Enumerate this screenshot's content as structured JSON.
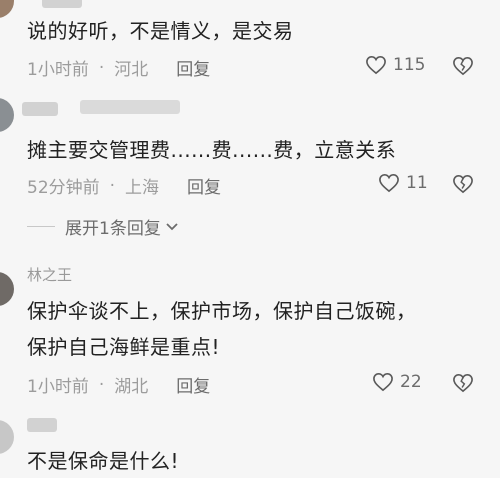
{
  "comments": [
    {
      "text": "说的好听，不是情义，是交易",
      "time": "1小时前",
      "location": "河北",
      "reply": "回复",
      "likes": "115"
    },
    {
      "text": "摊主要交管理费......费......费，立意关系",
      "time": "52分钟前",
      "location": "上海",
      "reply": "回复",
      "likes": "11",
      "expand": "展开1条回复"
    },
    {
      "name": "林之王",
      "text_line1": "保护伞谈不上，保护市场，保护自己饭碗，",
      "text_line2": "保护自己海鲜是重点!",
      "time": "1小时前",
      "location": "湖北",
      "reply": "回复",
      "likes": "22"
    },
    {
      "text": "不是保命是什么!"
    }
  ],
  "icons": {
    "like": "heart-outline-icon",
    "dislike": "broken-heart-icon",
    "expand": "chevron-down-icon"
  },
  "separator": "·"
}
